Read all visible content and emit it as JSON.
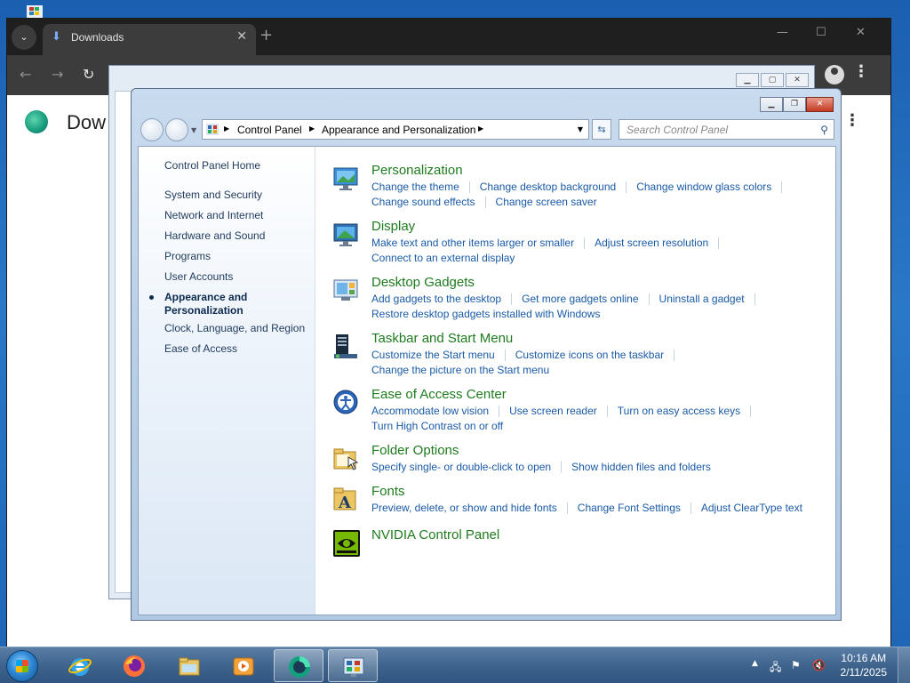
{
  "browser": {
    "tab_title": "Downloads",
    "tab_close": "✕",
    "new_tab": "+",
    "page_title": "Dow",
    "page_menu": "⋮",
    "menu": "⋮",
    "minimize": "—",
    "maximize": "☐",
    "close": "✕",
    "back": "←",
    "forward": "→",
    "reload": "↻"
  },
  "control_panel": {
    "breadcrumb": [
      "Control Panel",
      "Appearance and Personalization"
    ],
    "search_placeholder": "Search Control Panel",
    "sidebar": {
      "home": "Control Panel Home",
      "items": [
        "System and Security",
        "Network and Internet",
        "Hardware and Sound",
        "Programs",
        "User Accounts",
        "Appearance and Personalization",
        "Clock, Language, and Region",
        "Ease of Access"
      ],
      "active_index": 5
    },
    "categories": [
      {
        "title": "Personalization",
        "icon": "personalization-icon",
        "rows": [
          [
            "Change the theme",
            "Change desktop background",
            "Change window glass colors"
          ],
          [
            "Change sound effects",
            "Change screen saver"
          ]
        ]
      },
      {
        "title": "Display",
        "icon": "display-icon",
        "rows": [
          [
            "Make text and other items larger or smaller",
            "Adjust screen resolution"
          ],
          [
            "Connect to an external display"
          ]
        ]
      },
      {
        "title": "Desktop Gadgets",
        "icon": "gadgets-icon",
        "rows": [
          [
            "Add gadgets to the desktop",
            "Get more gadgets online",
            "Uninstall a gadget"
          ],
          [
            "Restore desktop gadgets installed with Windows"
          ]
        ]
      },
      {
        "title": "Taskbar and Start Menu",
        "icon": "taskbar-icon",
        "rows": [
          [
            "Customize the Start menu",
            "Customize icons on the taskbar"
          ],
          [
            "Change the picture on the Start menu"
          ]
        ]
      },
      {
        "title": "Ease of Access Center",
        "icon": "ease-of-access-icon",
        "rows": [
          [
            "Accommodate low vision",
            "Use screen reader",
            "Turn on easy access keys"
          ],
          [
            "Turn High Contrast on or off"
          ]
        ]
      },
      {
        "title": "Folder Options",
        "icon": "folder-options-icon",
        "rows": [
          [
            "Specify single- or double-click to open",
            "Show hidden files and folders"
          ]
        ]
      },
      {
        "title": "Fonts",
        "icon": "fonts-icon",
        "rows": [
          [
            "Preview, delete, or show and hide fonts",
            "Change Font Settings",
            "Adjust ClearType text"
          ]
        ]
      },
      {
        "title": "NVIDIA Control Panel",
        "icon": "nvidia-icon",
        "rows": []
      }
    ]
  },
  "taskbar": {
    "pinned": [
      "internet-explorer-icon",
      "firefox-icon",
      "file-explorer-icon",
      "media-player-icon",
      "browser-app-icon",
      "control-panel-icon"
    ],
    "time": "10:16 AM",
    "date": "2/11/2025"
  },
  "colors": {
    "link": "#1a5aa6",
    "category_title": "#1e7b1e",
    "taskbar": "#3f648d"
  }
}
